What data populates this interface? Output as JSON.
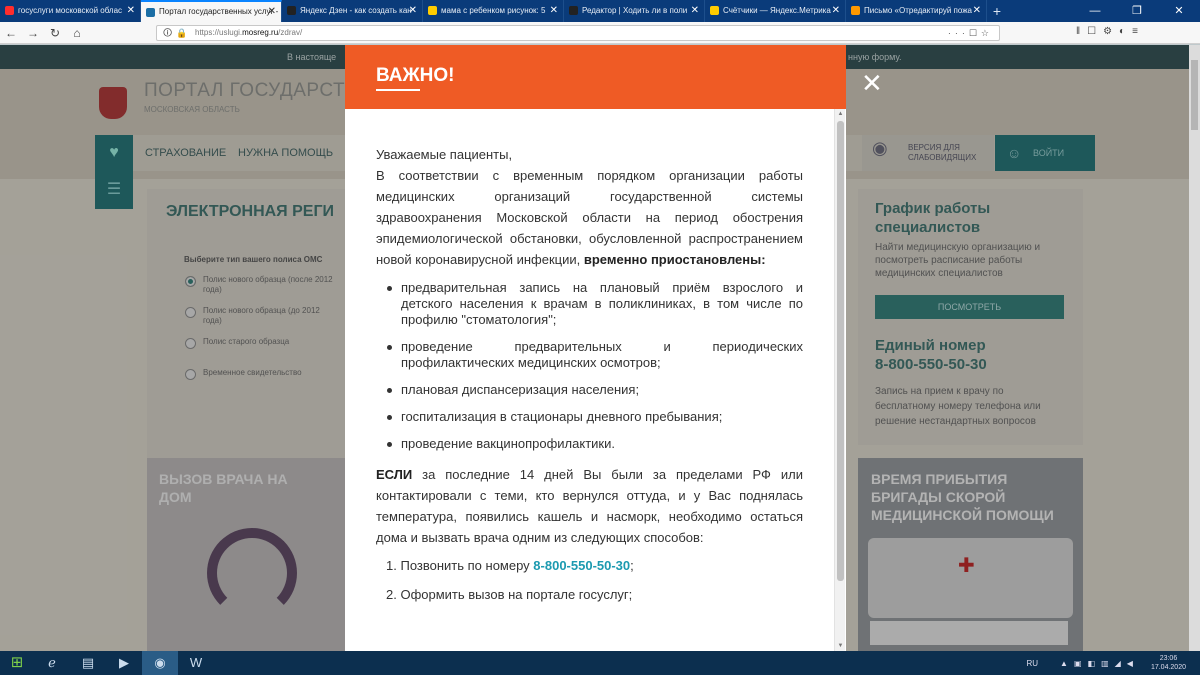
{
  "browser": {
    "tabs": [
      {
        "label": "госуслуги московской облас",
        "active": false,
        "favicon_color": "#ff2d2d"
      },
      {
        "label": "Портал государственных услуг -",
        "active": true,
        "favicon_color": "#1b6ea5"
      },
      {
        "label": "Яндекс Дзен - как создать кан",
        "active": false,
        "favicon_color": "#222222"
      },
      {
        "label": "мама с ребенком рисунок: 5",
        "active": false,
        "favicon_color": "#ffcc00"
      },
      {
        "label": "Редактор | Ходить ли в поли",
        "active": false,
        "favicon_color": "#222222"
      },
      {
        "label": "Счётчики — Яндекс.Метрика",
        "active": false,
        "favicon_color": "#ffcc00"
      },
      {
        "label": "Письмо «Отредактируй пожа",
        "active": false,
        "favicon_color": "#ff9900"
      }
    ],
    "new_tab_label": "+",
    "url_prefix": "https://uslugi.",
    "url_host": "mosreg.ru",
    "url_path": "/zdrav/"
  },
  "site": {
    "infobar_left": "В настояще",
    "infobar_right": "нную форму.",
    "portal_title": "ПОРТАЛ ГОСУДАРСТВЕННЫХ УСЛ",
    "portal_subtitle": "МОСКОВСКАЯ ОБЛАСТЬ",
    "menu": {
      "item1": "СТРАХОВАНИЕ",
      "item2": "НУЖНА ПОМОЩЬ",
      "low_vision": "ВЕРСИЯ ДЛЯ СЛАБОВИДЯЩИХ",
      "login": "ВОЙТИ"
    },
    "registration": {
      "title": "ЭЛЕКТРОННАЯ РЕГИ",
      "policy_label": "Выберите тип вашего полиса ОМС",
      "options": [
        "Полис нового образца (после 2012 года)",
        "Полис нового образца (до 2012 года)",
        "Полис старого образца",
        "Временное свидетельство"
      ]
    },
    "schedule": {
      "title": "График работы специалистов",
      "text": "Найти медицинскую организацию и посмотреть расписание работы медицинских специалистов",
      "button": "ПОСМОТРЕТЬ"
    },
    "hotline": {
      "title": "Единый номер",
      "phone": "8-800-550-50-30",
      "text": "Запись на прием к врачу по бесплатному номеру телефона или решение нестандартных вопросов"
    },
    "doctor_card": "ВЫЗОВ ВРАЧА НА ДОМ",
    "ambulance_card": "ВРЕМЯ ПРИБЫТИЯ БРИГАДЫ СКОРОЙ МЕДИЦИНСКОЙ ПОМОЩИ"
  },
  "modal": {
    "title": "ВАЖНО!",
    "greeting": "Уважаемые пациенты,",
    "intro": "В соответствии с временным порядком организации работы медицинских организаций государственной системы здравоохранения Московской области на период обострения эпидемиологической обстановки, обусловленной распространением новой коронавирусной инфекции,",
    "intro_bold": "временно приостановлены:",
    "suspended": [
      "предварительная запись на плановый приём взрослого и детского населения к врачам в поликлиниках, в том числе по профилю \"стоматология\";",
      "проведение предварительных и периодических профилактических медицинских осмотров;",
      "плановая диспансеризация населения;",
      "госпитализация в стационары дневного пребывания;",
      "проведение вакцинопрофилактики."
    ],
    "if_bold": "ЕСЛИ",
    "if_text": "за последние 14 дней Вы были за пределами РФ или контактировали с теми, кто вернулся оттуда, и у Вас поднялась температура, появились кашель и насморк, необходимо остаться дома и вызвать врача одним из следующих способов:",
    "ways": [
      {
        "num": "1.",
        "text": "Позвонить по номеру",
        "phone": "8-800-550-50-30",
        "tail": ";"
      },
      {
        "num": "2.",
        "text": "Оформить вызов на портале госуслуг;",
        "phone": "",
        "tail": ""
      }
    ],
    "close_symbol": "✕"
  },
  "taskbar": {
    "lang": "RU",
    "time": "23:06",
    "date": "17.04.2020"
  },
  "colors": {
    "modal_header": "#ef5b25",
    "phone_link": "#1c9ab0",
    "site_accent": "#1f6f72"
  }
}
